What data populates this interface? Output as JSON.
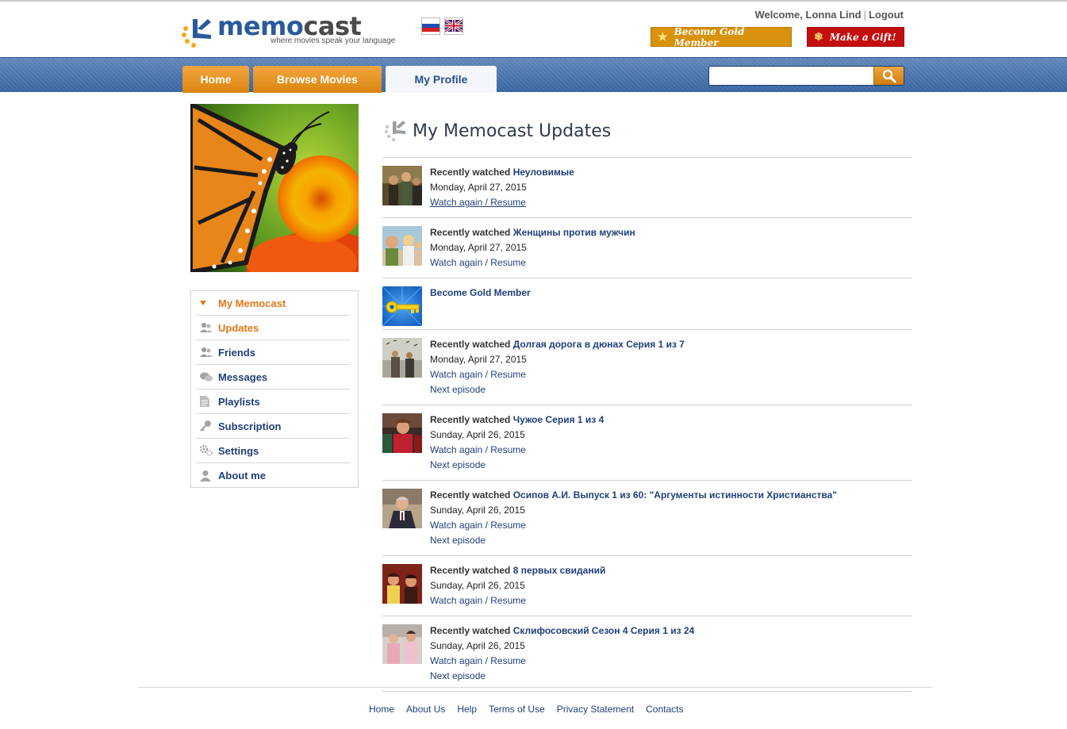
{
  "app": {
    "logo_name_a": "memo",
    "logo_name_b": "cast",
    "tagline": "where movies speak your language",
    "brand_blue": "#2b5a9b",
    "accent_orange": "#e07816"
  },
  "header": {
    "welcome": "Welcome, Lonna Lind",
    "separator": "|",
    "logout": "Logout",
    "gold_button": "Become Gold Member",
    "gift_button": "Make a Gift!",
    "flags": [
      "russian-flag-icon",
      "uk-flag-icon"
    ]
  },
  "nav": {
    "tabs": [
      {
        "label": "Home"
      },
      {
        "label": "Browse Movies"
      },
      {
        "label": "My Profile"
      }
    ],
    "search_placeholder": "",
    "search_value": ""
  },
  "sidebar": {
    "items": [
      {
        "label": "My Memocast",
        "icon": "triangle-down-icon"
      },
      {
        "label": "Updates",
        "icon": "users-icon"
      },
      {
        "label": "Friends",
        "icon": "users-icon"
      },
      {
        "label": "Messages",
        "icon": "chat-bubbles-icon"
      },
      {
        "label": "Playlists",
        "icon": "document-icon"
      },
      {
        "label": "Subscription",
        "icon": "key-icon"
      },
      {
        "label": "Settings",
        "icon": "gears-icon"
      },
      {
        "label": "About me",
        "icon": "person-icon"
      }
    ]
  },
  "main": {
    "title": "My Memocast Updates",
    "lead": "Recently watched",
    "watch_again": "Watch again / Resume",
    "next_episode": "Next episode",
    "gold_entry": "Become Gold Member",
    "items": [
      {
        "title": "Неуловимые",
        "date": "Monday, April 27, 2015"
      },
      {
        "title": "Женщины против мужчин",
        "date": "Monday, April 27, 2015"
      },
      {
        "title": "Долгая дорога в дюнах Серия 1 из 7",
        "date": "Monday, April 27, 2015"
      },
      {
        "title": "Чужое Серия 1 из 4",
        "date": "Sunday, April 26, 2015"
      },
      {
        "title": "Осипов А.И. Выпуск 1 из 60: \"Аргументы истинности Христианства\"",
        "date": "Sunday, April 26, 2015"
      },
      {
        "title": "8 первых свиданий",
        "date": "Sunday, April 26, 2015"
      },
      {
        "title": "Склифосовский Сезон 4 Серия 1 из 24",
        "date": "Sunday, April 26, 2015"
      }
    ]
  },
  "footer": {
    "links": [
      "Home",
      "About Us",
      "Help",
      "Terms of Use",
      "Privacy Statement",
      "Contacts"
    ]
  }
}
